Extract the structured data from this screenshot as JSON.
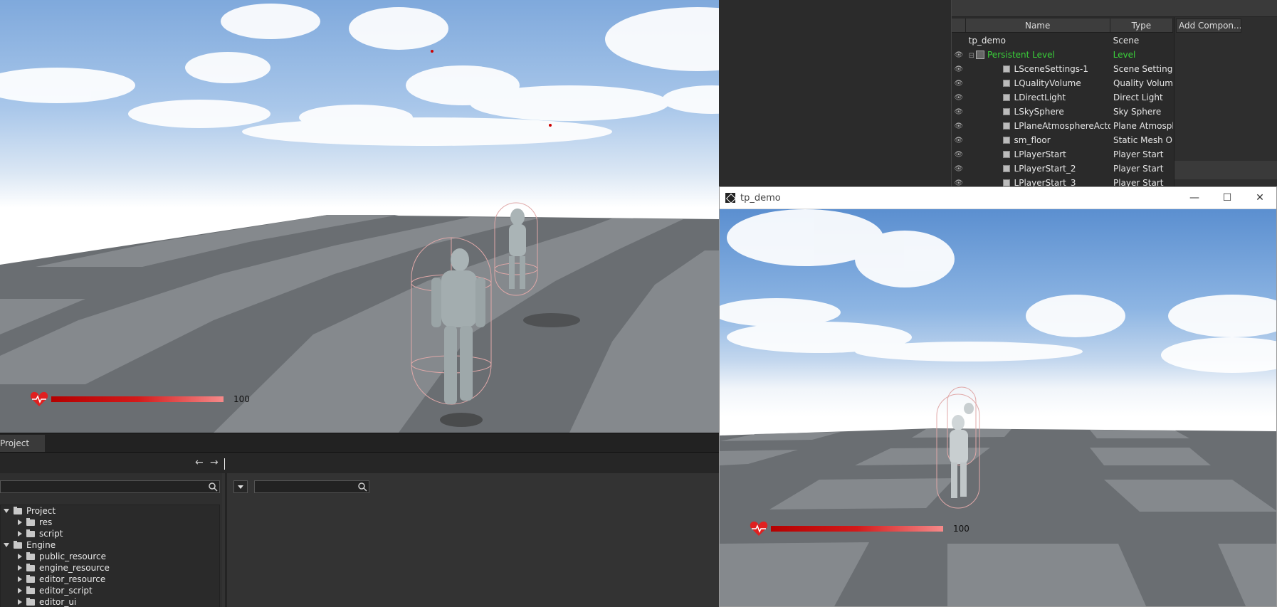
{
  "viewport": {
    "health_value": "100"
  },
  "outliner": {
    "columns": {
      "name": "Name",
      "type": "Type"
    },
    "add_component_label": "Add Compon...",
    "rows": [
      {
        "name": "tp_demo",
        "type": "Scene"
      },
      {
        "name": "Persistent Level",
        "type": "Level"
      },
      {
        "name": "LSceneSettings-1",
        "type": "Scene Settings"
      },
      {
        "name": "LQualityVolume",
        "type": "Quality Volume"
      },
      {
        "name": "LDirectLight",
        "type": "Direct Light"
      },
      {
        "name": "LSkySphere",
        "type": "Sky Sphere"
      },
      {
        "name": "LPlaneAtmosphereActor",
        "type": "Plane Atmosph"
      },
      {
        "name": "sm_floor",
        "type": "Static Mesh Ob"
      },
      {
        "name": "LPlayerStart",
        "type": "Player Start"
      },
      {
        "name": "LPlayerStart_2",
        "type": "Player Start"
      },
      {
        "name": "LPlayerStart_3",
        "type": "Player Start"
      }
    ],
    "level_color": "#3ad13a"
  },
  "game_window": {
    "title": "tp_demo",
    "health_value": "100",
    "minimize_glyph": "—",
    "maximize_glyph": "☐",
    "close_glyph": "✕"
  },
  "project": {
    "tab_label": "Project",
    "back_glyph": "←",
    "forward_glyph": "→",
    "tree": [
      {
        "label": "Project",
        "level": 0,
        "expanded": true
      },
      {
        "label": "res",
        "level": 1,
        "expanded": false
      },
      {
        "label": "script",
        "level": 1,
        "expanded": false
      },
      {
        "label": "Engine",
        "level": 0,
        "expanded": true
      },
      {
        "label": "public_resource",
        "level": 1,
        "expanded": false
      },
      {
        "label": "engine_resource",
        "level": 1,
        "expanded": false
      },
      {
        "label": "editor_resource",
        "level": 1,
        "expanded": false
      },
      {
        "label": "editor_script",
        "level": 1,
        "expanded": false
      },
      {
        "label": "editor_ui",
        "level": 1,
        "expanded": false
      }
    ]
  },
  "icons": {
    "visibility": "eye-icon",
    "actor": "cube-icon",
    "search": "search-icon",
    "folder": "folder-icon",
    "health": "heart-icon"
  }
}
